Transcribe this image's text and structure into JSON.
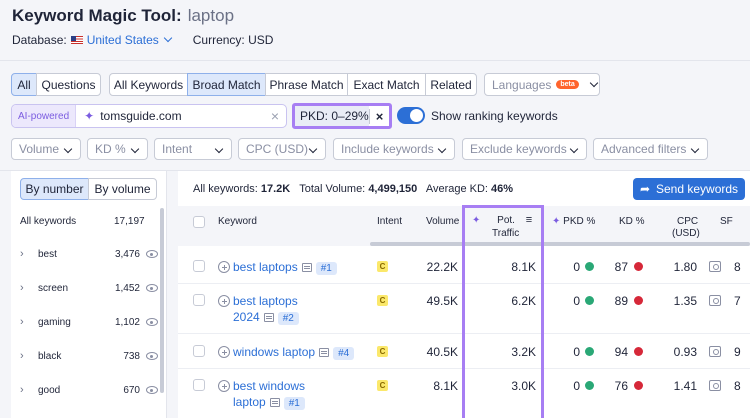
{
  "header": {
    "title": "Keyword Magic Tool:",
    "query": "laptop",
    "database_label": "Database:",
    "database_value": "United States",
    "currency": "Currency: USD"
  },
  "match_tabs": {
    "all": "All",
    "questions": "Questions",
    "all_keywords": "All Keywords",
    "broad_match": "Broad Match",
    "phrase_match": "Phrase Match",
    "exact_match": "Exact Match",
    "related": "Related",
    "languages": "Languages",
    "beta": "beta"
  },
  "ai_row": {
    "tag": "AI-powered",
    "domain": "tomsguide.com",
    "pkd_filter": "PKD: 0–29%",
    "toggle_label": "Show ranking keywords",
    "toggle_on": true
  },
  "filters": [
    "Volume",
    "KD %",
    "Intent",
    "CPC (USD)",
    "Include keywords",
    "Exclude keywords",
    "Advanced filters"
  ],
  "left_panel": {
    "by_number": "By number",
    "by_volume": "By volume",
    "header_label": "All keywords",
    "header_count": "17,197",
    "groups": [
      {
        "name": "best",
        "count": "3,476"
      },
      {
        "name": "screen",
        "count": "1,452"
      },
      {
        "name": "gaming",
        "count": "1,102"
      },
      {
        "name": "black",
        "count": "738"
      },
      {
        "name": "good",
        "count": "670"
      }
    ]
  },
  "summary": {
    "all_keywords_label": "All keywords:",
    "all_keywords_value": "17.2K",
    "total_volume_label": "Total Volume:",
    "total_volume_value": "4,499,150",
    "avg_kd_label": "Average KD:",
    "avg_kd_value": "46%",
    "send_button": "Send keywords"
  },
  "table": {
    "headers": {
      "keyword": "Keyword",
      "intent": "Intent",
      "volume": "Volume",
      "pot_traffic_1": "Pot.",
      "pot_traffic_2": "Traffic",
      "pkd": "PKD %",
      "kd": "KD %",
      "cpc_1": "CPC",
      "cpc_2": "(USD)",
      "sf": "SF"
    },
    "rows": [
      {
        "kw1": "best laptops",
        "kw2": "",
        "rank": "#1",
        "intent": "C",
        "volume": "22.2K",
        "traffic": "8.1K",
        "pkd": "0",
        "pkd_color": "#2aa876",
        "kd": "87",
        "kd_color": "#d62839",
        "cpc": "1.80",
        "sf": "8"
      },
      {
        "kw1": "best laptops",
        "kw2": "2024",
        "rank": "#2",
        "intent": "C",
        "volume": "49.5K",
        "traffic": "6.2K",
        "pkd": "0",
        "pkd_color": "#2aa876",
        "kd": "89",
        "kd_color": "#d62839",
        "cpc": "1.35",
        "sf": "7"
      },
      {
        "kw1": "windows laptop",
        "kw2": "",
        "rank": "#4",
        "intent": "C",
        "volume": "40.5K",
        "traffic": "3.2K",
        "pkd": "0",
        "pkd_color": "#2aa876",
        "kd": "94",
        "kd_color": "#d62839",
        "cpc": "0.93",
        "sf": "9"
      },
      {
        "kw1": "best windows",
        "kw2": "laptop",
        "rank": "#1",
        "intent": "C",
        "volume": "8.1K",
        "traffic": "3.0K",
        "pkd": "0",
        "pkd_color": "#2aa876",
        "kd": "76",
        "kd_color": "#d62839",
        "cpc": "1.41",
        "sf": "8"
      }
    ]
  }
}
